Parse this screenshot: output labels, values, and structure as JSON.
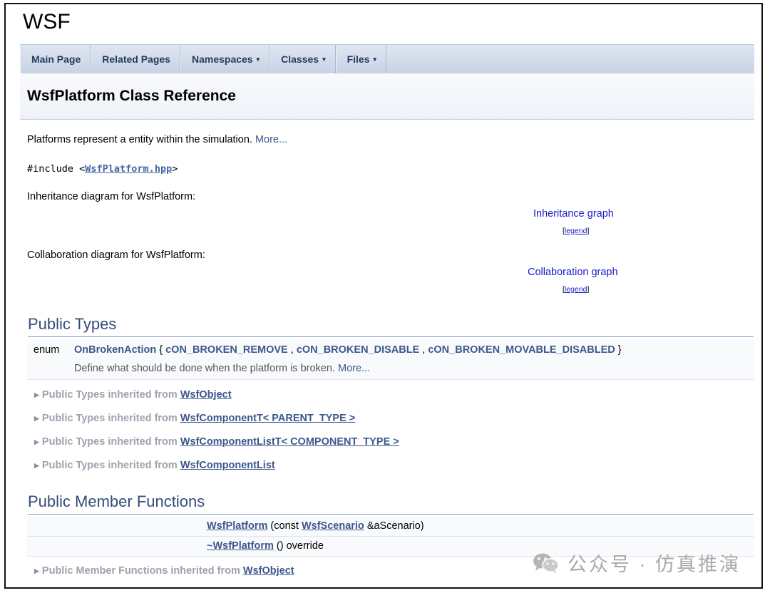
{
  "project": {
    "name": "WSF"
  },
  "nav": {
    "items": [
      {
        "label": "Main Page",
        "dropdown": false
      },
      {
        "label": "Related Pages",
        "dropdown": false
      },
      {
        "label": "Namespaces",
        "dropdown": true
      },
      {
        "label": "Classes",
        "dropdown": true
      },
      {
        "label": "Files",
        "dropdown": true
      }
    ],
    "dropdown_icon": "▾"
  },
  "page": {
    "title": "WsfPlatform Class Reference"
  },
  "brief": {
    "text": "Platforms represent a entity within the simulation. ",
    "more": "More..."
  },
  "include": {
    "prefix": "#include <",
    "file": "WsfPlatform.hpp",
    "suffix": ">"
  },
  "inheritance": {
    "label": "Inheritance diagram for WsfPlatform:",
    "link": "Inheritance graph",
    "legend": "legend"
  },
  "collaboration": {
    "label": "Collaboration diagram for WsfPlatform:",
    "link": "Collaboration graph",
    "legend": "legend"
  },
  "public_types": {
    "heading": "Public Types",
    "enum": {
      "keyword": "enum",
      "name": "OnBrokenAction",
      "open": " { ",
      "values": [
        "cON_BROKEN_REMOVE",
        "cON_BROKEN_DISABLE",
        "cON_BROKEN_MOVABLE_DISABLED"
      ],
      "close": " }",
      "desc": "Define what should be done when the platform is broken. ",
      "more": "More..."
    },
    "inherited": [
      {
        "prefix": "Public Types inherited from ",
        "cls": "WsfObject"
      },
      {
        "prefix": "Public Types inherited from ",
        "cls": "WsfComponentT< PARENT_TYPE >"
      },
      {
        "prefix": "Public Types inherited from ",
        "cls": "WsfComponentListT< COMPONENT_TYPE >"
      },
      {
        "prefix": "Public Types inherited from ",
        "cls": "WsfComponentList"
      }
    ]
  },
  "public_functions": {
    "heading": "Public Member Functions",
    "rows": [
      {
        "name": "WsfPlatform",
        "pre": " (const ",
        "type": "WsfScenario",
        "post": " &aScenario)"
      },
      {
        "name": "~WsfPlatform",
        "pre": " () override",
        "type": "",
        "post": ""
      }
    ],
    "inherited": [
      {
        "prefix": "Public Member Functions inherited from ",
        "cls": "WsfObject"
      }
    ]
  },
  "watermark": {
    "text": "公众号 · 仿真推演",
    "icon": "wechat-icon"
  }
}
